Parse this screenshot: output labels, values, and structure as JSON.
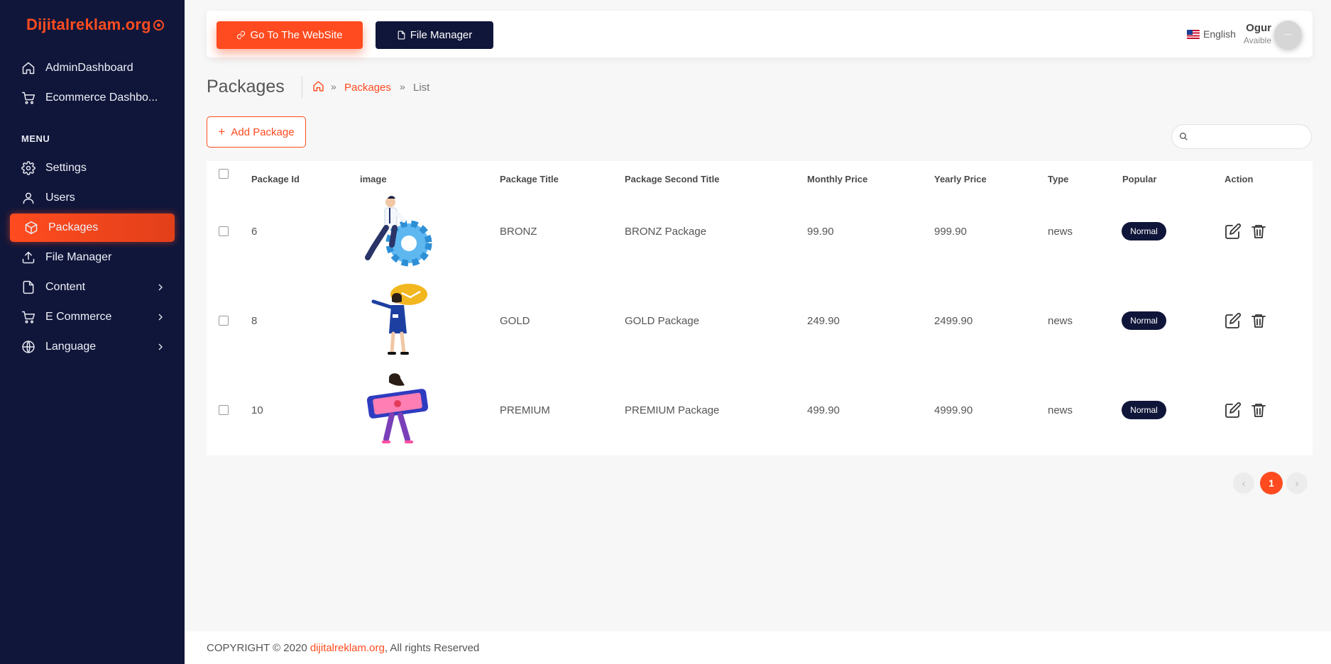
{
  "brand": {
    "name": "Dijitalreklam.org"
  },
  "sidebar": {
    "items_top": [
      {
        "label": "AdminDashboard",
        "icon": "home-icon"
      },
      {
        "label": "Ecommerce Dashbo...",
        "icon": "cart-icon"
      }
    ],
    "menu_label": "MENU",
    "items": [
      {
        "label": "Settings",
        "icon": "gear-icon"
      },
      {
        "label": "Users",
        "icon": "user-icon"
      },
      {
        "label": "Packages",
        "icon": "box-icon",
        "active": true
      },
      {
        "label": "File Manager",
        "icon": "upload-icon"
      },
      {
        "label": "Content",
        "icon": "file-icon",
        "has_children": true
      },
      {
        "label": "E Commerce",
        "icon": "cart-icon",
        "has_children": true
      },
      {
        "label": "Language",
        "icon": "globe-icon",
        "has_children": true
      }
    ]
  },
  "topbar": {
    "go_site_label": "Go To The WebSite",
    "file_manager_label": "File Manager",
    "language": "English",
    "user_name": "Ogur",
    "user_status": "Avaible"
  },
  "page": {
    "title": "Packages",
    "breadcrumb": {
      "link": "Packages",
      "current": "List",
      "separator": "»"
    },
    "add_button": "Add Package",
    "search_placeholder": ""
  },
  "table": {
    "columns": [
      "Package Id",
      "image",
      "Package Title",
      "Package Second Title",
      "Monthly Price",
      "Yearly Price",
      "Type",
      "Popular",
      "Action"
    ],
    "rows": [
      {
        "id": "6",
        "title": "BRONZ",
        "second_title": "BRONZ Package",
        "monthly": "99.90",
        "yearly": "999.90",
        "type": "news",
        "popular": "Normal"
      },
      {
        "id": "8",
        "title": "GOLD",
        "second_title": "GOLD Package",
        "monthly": "249.90",
        "yearly": "2499.90",
        "type": "news",
        "popular": "Normal"
      },
      {
        "id": "10",
        "title": "PREMIUM",
        "second_title": "PREMIUM Package",
        "monthly": "499.90",
        "yearly": "4999.90",
        "type": "news",
        "popular": "Normal"
      }
    ]
  },
  "pagination": {
    "current": "1",
    "prev": "‹",
    "next": "›"
  },
  "footer": {
    "prefix": "COPYRIGHT © 2020 ",
    "link": "dijitalreklam.org",
    "suffix": ", All rights Reserved"
  },
  "colors": {
    "accent": "#ff4b1f",
    "sidebar_bg": "#10163a",
    "page_bg": "#f7f7f7"
  }
}
